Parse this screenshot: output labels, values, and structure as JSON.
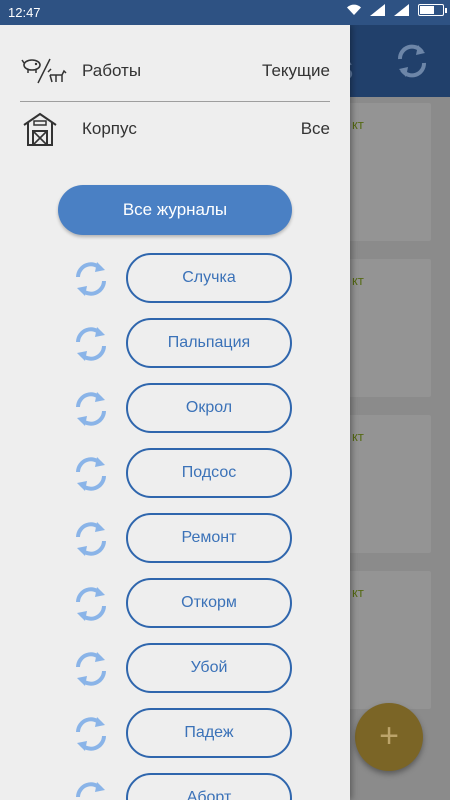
{
  "status_bar": {
    "time": "12:47"
  },
  "drawer": {
    "filters": [
      {
        "icon": "livestock-icon",
        "label": "Работы",
        "value": "Текущие"
      },
      {
        "icon": "barn-icon",
        "label": "Корпус",
        "value": "Все"
      }
    ],
    "all_journals_label": "Все журналы",
    "journals": [
      "Случка",
      "Пальпация",
      "Окрол",
      "Подсос",
      "Ремонт",
      "Откорм",
      "Убой",
      "Падеж",
      "Аборт"
    ]
  },
  "background": {
    "card_label": "кт",
    "fab_label": "+"
  },
  "colors": {
    "status_bar": "#2e5283",
    "accent": "#4a80c4",
    "outline": "#2f66ad",
    "sync_icon": "#8ab4e8",
    "drawer_bg": "#eeeeee"
  }
}
